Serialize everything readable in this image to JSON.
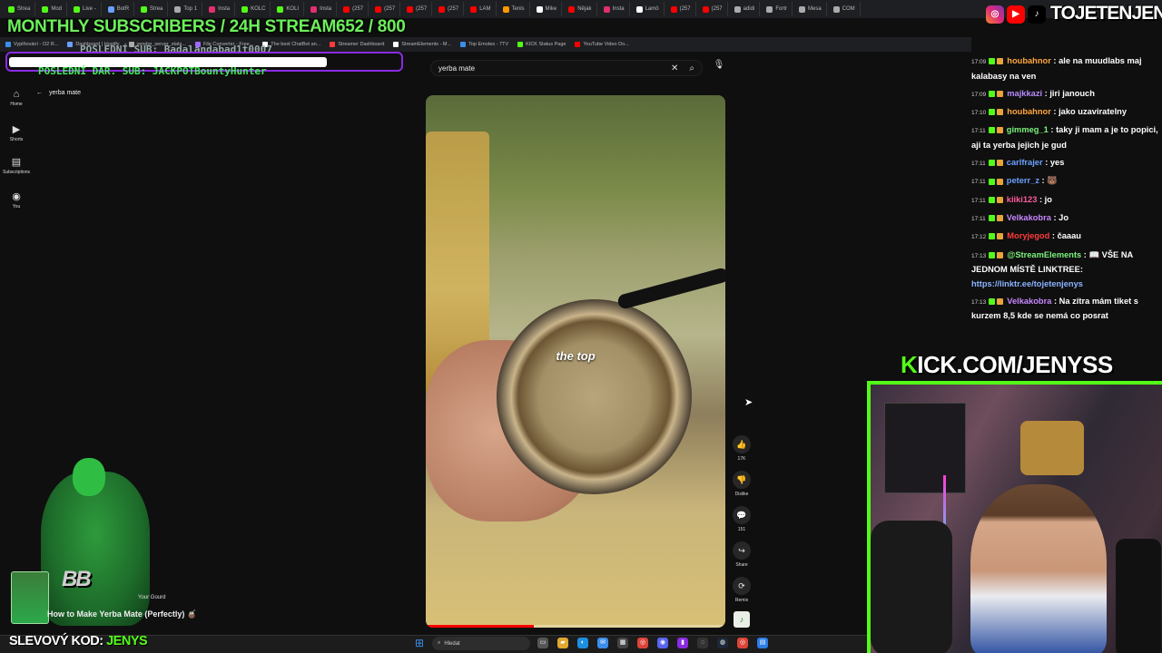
{
  "browser": {
    "tabs": [
      {
        "label": "Strea",
        "color": "#53fc18"
      },
      {
        "label": "Mod",
        "color": "#53fc18"
      },
      {
        "label": "Live -",
        "color": "#53fc18"
      },
      {
        "label": "BotR",
        "color": "#6aa0ff"
      },
      {
        "label": "Strea",
        "color": "#53fc18"
      },
      {
        "label": "Top 1",
        "color": "#aaaaaa"
      },
      {
        "label": "Insta",
        "color": "#e1306c"
      },
      {
        "label": "KOLC",
        "color": "#53fc18"
      },
      {
        "label": "KOLI",
        "color": "#53fc18"
      },
      {
        "label": "Insta",
        "color": "#e1306c"
      },
      {
        "label": "(257",
        "color": "#ff0000"
      },
      {
        "label": "(257",
        "color": "#ff0000"
      },
      {
        "label": "(257",
        "color": "#ff0000"
      },
      {
        "label": "(257",
        "color": "#ff0000"
      },
      {
        "label": "LAM",
        "color": "#ff0000"
      },
      {
        "label": "Tenis",
        "color": "#ff9800"
      },
      {
        "label": "Mike",
        "color": "#ffffff"
      },
      {
        "label": "Nějak",
        "color": "#ff0000"
      },
      {
        "label": "Insta",
        "color": "#e1306c"
      },
      {
        "label": "Lamö",
        "color": "#ffffff"
      },
      {
        "label": "(257",
        "color": "#ff0000"
      },
      {
        "label": "(257",
        "color": "#ff0000"
      },
      {
        "label": "adidi",
        "color": "#aaaaaa"
      },
      {
        "label": "Fortr",
        "color": "#aaaaaa"
      },
      {
        "label": "Mesa",
        "color": "#aaaaaa"
      },
      {
        "label": "COM",
        "color": "#aaaaaa"
      }
    ],
    "bookmarks": [
      {
        "label": "Vyplňování - O2 R...",
        "color": "#3b8eea"
      },
      {
        "label": "Dashboard | Hostify",
        "color": "#6aa0ff"
      },
      {
        "label": "vendor_server_stats...",
        "color": "#aaaaaa"
      },
      {
        "label": "File Converter - Free...",
        "color": "#9c6cff"
      },
      {
        "label": "The best ChatBot an...",
        "color": "#ffffff"
      },
      {
        "label": "Streamer Dashboard",
        "color": "#ff3b3b"
      },
      {
        "label": "StreamElements - M...",
        "color": "#ffffff"
      },
      {
        "label": "Top Emotes - 7TV",
        "color": "#3b8eea"
      },
      {
        "label": "KICK Status Page",
        "color": "#53fc18"
      },
      {
        "label": "YouTube Video Do...",
        "color": "#ff0000"
      }
    ]
  },
  "overlay": {
    "goal_title": "MONTHLY SUBSCRIBERS / 24H STREAM652 / 800",
    "last_sub_1": "POSLEDNÍ SUB: Badalandabad1t0007",
    "last_sub_2": "POSLEDNÍ DAR. SUB: JACKPOTBountyHunter",
    "brand": "TOJETENJENYS",
    "kick_prefix": "K",
    "kick_rest": "ICK.COM/JENYSS",
    "promo_prefix": "SLEVOVÝ KOD: ",
    "promo_code": "JENYS",
    "booster_text": "BB",
    "social_icons": [
      "instagram-icon",
      "youtube-icon",
      "tiktok-icon"
    ]
  },
  "youtube": {
    "nav": [
      {
        "label": "Home",
        "icon": "⌂"
      },
      {
        "label": "Shorts",
        "icon": "▶"
      },
      {
        "label": "Subscriptions",
        "icon": "▤"
      },
      {
        "label": "You",
        "icon": "◉"
      }
    ],
    "back_label": "yerba mate",
    "search_value": "yerba mate",
    "caption": "the top",
    "progress": 0.36,
    "actions": [
      {
        "name": "like",
        "icon": "👍",
        "label": "17K"
      },
      {
        "name": "dislike",
        "icon": "👎",
        "label": "Dislike"
      },
      {
        "name": "comments",
        "icon": "💬",
        "label": "151"
      },
      {
        "name": "share",
        "icon": "↪",
        "label": "Share"
      },
      {
        "name": "remix",
        "icon": "⟳",
        "label": "Remix"
      }
    ],
    "suggestion_gourd": "Your Gourd",
    "suggestion_title": "How to Make Yerba Mate (Perfectly) 🧉"
  },
  "chat": [
    {
      "time": "17:09",
      "user": "houbahnor",
      "color": "#ffa640",
      "text": "ale na muudlabs maj kalabasy na ven"
    },
    {
      "time": "17:09",
      "user": "majkkazi",
      "color": "#b78cff",
      "text": "jiri janouch"
    },
    {
      "time": "17:10",
      "user": "houbahnor",
      "color": "#ffa640",
      "text": "jako uzaviratelny"
    },
    {
      "time": "17:11",
      "user": "gimmeg_1",
      "color": "#7cf27c",
      "text": "taky ji mam a je to popici, aji ta yerba jejich je gud"
    },
    {
      "time": "17:11",
      "user": "carlfrajer",
      "color": "#6aa0ff",
      "text": "yes"
    },
    {
      "time": "17:11",
      "user": "peterr_z",
      "color": "#6aa0ff",
      "text": "🐻"
    },
    {
      "time": "17:11",
      "user": "kiiki123",
      "color": "#ff5aa0",
      "text": "jo"
    },
    {
      "time": "17:11",
      "user": "Velkakobra",
      "color": "#c887ff",
      "text": "Jo"
    },
    {
      "time": "17:12",
      "user": "Moryjegod",
      "color": "#ff3b3b",
      "text": "čaaau"
    },
    {
      "time": "17:13",
      "user": "@StreamElements",
      "color": "#7cf27c",
      "text": "📖 VŠE NA JEDNOM MÍSTĚ LINKTREE: ",
      "link": "https://linktr.ee/tojetenjenys"
    },
    {
      "time": "17:13",
      "user": "Velkakobra",
      "color": "#c887ff",
      "text": "Na zítra mám tiket s kurzem 8,5 kde se nemá co posrat"
    }
  ],
  "taskbar": {
    "search_placeholder": "Hledat",
    "icons": [
      {
        "name": "files-icon",
        "glyph": "▭",
        "color": "#555555"
      },
      {
        "name": "folder-icon",
        "glyph": "▰",
        "color": "#e0a82e"
      },
      {
        "name": "edge-icon",
        "glyph": "◐",
        "color": "#1d8fe0"
      },
      {
        "name": "mail-icon",
        "glyph": "✉",
        "color": "#3b8eea"
      },
      {
        "name": "store-icon",
        "glyph": "▦",
        "color": "#444444"
      },
      {
        "name": "chrome-icon",
        "glyph": "◎",
        "color": "#db4437"
      },
      {
        "name": "discord-icon",
        "glyph": "◉",
        "color": "#5865f2"
      },
      {
        "name": "app-icon",
        "glyph": "▮",
        "color": "#8a2be2"
      },
      {
        "name": "obs-icon",
        "glyph": "◌",
        "color": "#333333"
      },
      {
        "name": "steam-icon",
        "glyph": "◍",
        "color": "#1b2838"
      },
      {
        "name": "chrome2-icon",
        "glyph": "◎",
        "color": "#db4437"
      },
      {
        "name": "note-icon",
        "glyph": "▤",
        "color": "#2b7de9"
      }
    ]
  }
}
